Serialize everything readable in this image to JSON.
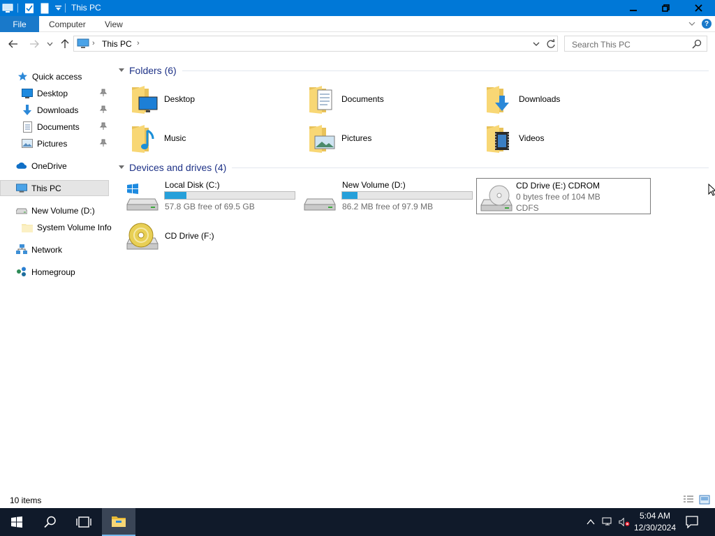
{
  "window": {
    "title": "This PC"
  },
  "ribbon": {
    "tabs": [
      {
        "label": "File"
      },
      {
        "label": "Computer"
      },
      {
        "label": "View"
      }
    ],
    "help_label": "?"
  },
  "address": {
    "path_item": "This PC"
  },
  "search": {
    "placeholder": "Search This PC"
  },
  "sidebar": {
    "quick_access": "Quick access",
    "items": [
      {
        "label": "Desktop",
        "icon": "desktop-icon",
        "pinned": true
      },
      {
        "label": "Downloads",
        "icon": "downloads-icon",
        "pinned": true
      },
      {
        "label": "Documents",
        "icon": "documents-icon",
        "pinned": true
      },
      {
        "label": "Pictures",
        "icon": "pictures-icon",
        "pinned": true
      }
    ],
    "onedrive": "OneDrive",
    "this_pc": "This PC",
    "new_volume": "New Volume (D:)",
    "system_volume": "System Volume Info",
    "network": "Network",
    "homegroup": "Homegroup"
  },
  "folders": {
    "header": "Folders (6)",
    "items": [
      {
        "name": "Desktop"
      },
      {
        "name": "Documents"
      },
      {
        "name": "Downloads"
      },
      {
        "name": "Music"
      },
      {
        "name": "Pictures"
      },
      {
        "name": "Videos"
      }
    ]
  },
  "drives": {
    "header": "Devices and drives (4)",
    "items": [
      {
        "name": "Local Disk (C:)",
        "free": "57.8 GB free of 69.5 GB",
        "used_fraction": 0.168
      },
      {
        "name": "New Volume (D:)",
        "free": "86.2 MB free of 97.9 MB",
        "used_fraction": 0.12
      },
      {
        "name": "CD Drive (E:) CDROM",
        "free": "0 bytes free of 104 MB",
        "fs": "CDFS"
      },
      {
        "name": "CD Drive (F:)"
      }
    ]
  },
  "status": {
    "item_count": "10 items"
  },
  "taskbar": {
    "time": "5:04 AM",
    "date": "12/30/2024"
  },
  "colors": {
    "titlebar": "#0078d7",
    "file_tab": "#1979ca",
    "drive_bar": "#26a0da",
    "group_header": "#1e3287",
    "taskbar": "#101a2a"
  }
}
